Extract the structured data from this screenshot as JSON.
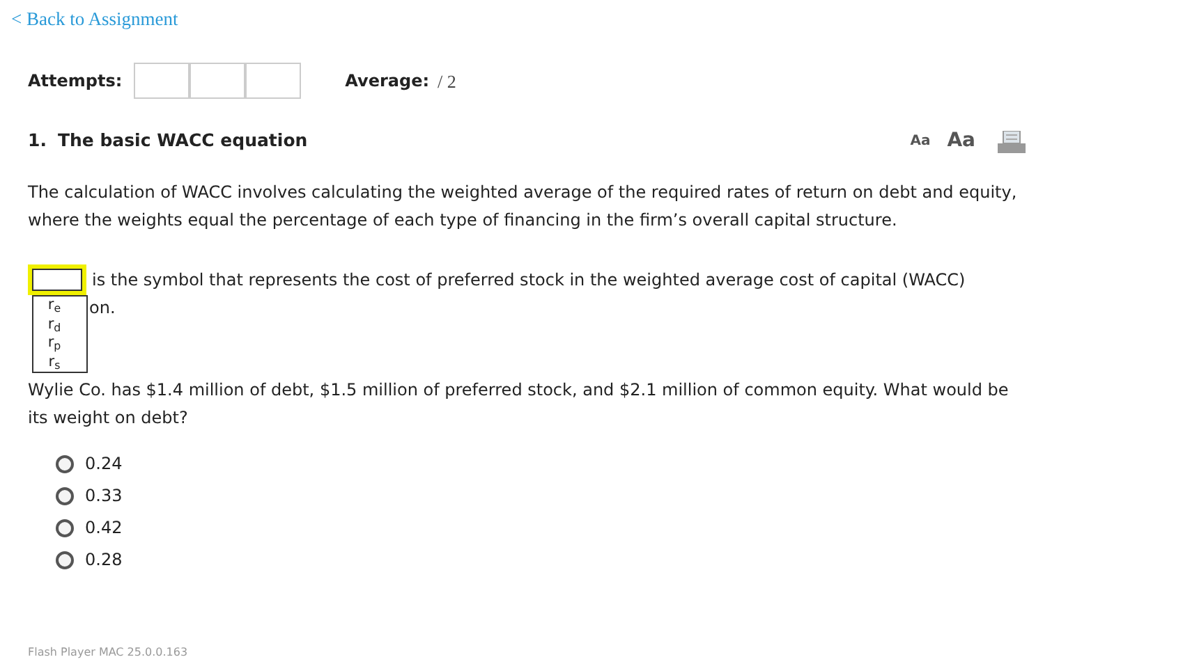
{
  "back_link": "< Back to Assignment",
  "attempts": {
    "label": "Attempts:"
  },
  "average": {
    "label": "Average:",
    "value": "/ 2"
  },
  "question": {
    "number": "1.",
    "title": "The basic WACC equation"
  },
  "toolbar": [
    {
      "kind": "small-text",
      "label": "Aa"
    },
    {
      "kind": "large-text",
      "label": "Aa"
    },
    {
      "kind": "print"
    }
  ],
  "intro": "The calculation of WACC involves calculating the weighted average of the required rates of return on debt and equity, where the weights equal the percentage of each type of financing in the firm’s overall capital structure.",
  "blank": {
    "expanded": true,
    "focused": true,
    "after": "is the symbol that represents the cost of preferred stock in the weighted average cost of capital (WACC)",
    "continued": "on.",
    "options": [
      {
        "label": "r$_{e}$"
      },
      {
        "label": "r$_{d}$"
      },
      {
        "label": "r$_{p}$"
      },
      {
        "label": "r$_{s}$"
      }
    ]
  },
  "question2": "Wylie Co. has $1.4 million of debt, $1.5 million of preferred stock, and $2.1 million of common equity. What would be its weight on debt?",
  "choices": [
    {
      "label": "0.24",
      "selected": false
    },
    {
      "label": "0.33",
      "selected": false
    },
    {
      "label": "0.42",
      "selected": false
    },
    {
      "label": "0.28",
      "selected": false
    }
  ],
  "footer": "Flash Player MAC 25.0.0.163"
}
